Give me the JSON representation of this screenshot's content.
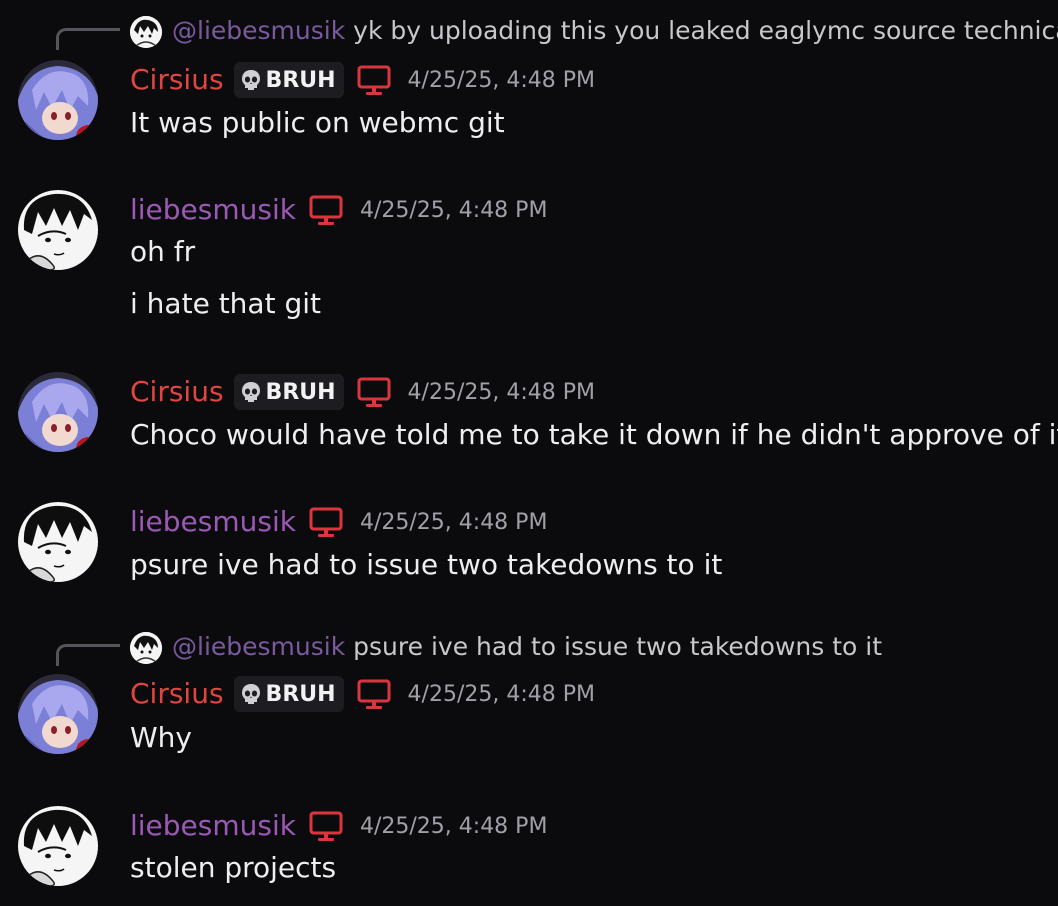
{
  "messages": [
    {
      "reply": {
        "mention": "@liebesmusik",
        "text": "yk by uploading this you leaked eaglymc source technically"
      },
      "author": "Cirsius",
      "badge": "BRUH",
      "timestamp": "4/25/25, 4:48 PM",
      "lines": [
        "It was public on webmc git"
      ]
    },
    {
      "author": "liebesmusik",
      "timestamp": "4/25/25, 4:48 PM",
      "lines": [
        "oh fr",
        "i hate that git"
      ]
    },
    {
      "author": "Cirsius",
      "badge": "BRUH",
      "timestamp": "4/25/25, 4:48 PM",
      "lines": [
        "Choco would have told me to take it down if he didn't approve of it"
      ]
    },
    {
      "author": "liebesmusik",
      "timestamp": "4/25/25, 4:48 PM",
      "lines": [
        "psure ive had to issue two takedowns to it"
      ]
    },
    {
      "reply": {
        "mention": "@liebesmusik",
        "text": "psure ive had to issue two takedowns to it"
      },
      "author": "Cirsius",
      "badge": "BRUH",
      "timestamp": "4/25/25, 4:48 PM",
      "lines": [
        "Why"
      ]
    },
    {
      "author": "liebesmusik",
      "timestamp": "4/25/25, 4:48 PM",
      "lines": [
        "stolen projects"
      ]
    }
  ],
  "colors": {
    "background": "#0b0b0d",
    "cirsius_name": "#e0453e",
    "liebesmusik_name": "#9b59b6",
    "mention": "#7a5a9e",
    "device_icon": "#d9363e",
    "timestamp": "#a0a0a8"
  },
  "icons": {
    "badge": "skull-icon",
    "device": "desktop-monitor-icon"
  }
}
